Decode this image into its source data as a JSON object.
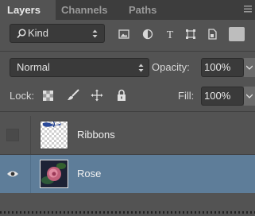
{
  "tabs": [
    {
      "label": "Layers",
      "active": true
    },
    {
      "label": "Channels",
      "active": false
    },
    {
      "label": "Paths",
      "active": false
    }
  ],
  "filter": {
    "kind_label": "Kind",
    "icons": [
      "search-icon",
      "image-filter-icon",
      "adjustment-filter-icon",
      "type-filter-icon",
      "shape-filter-icon",
      "smart-object-filter-icon"
    ]
  },
  "blend": {
    "mode": "Normal",
    "opacity_label": "Opacity:",
    "opacity_value": "100%"
  },
  "lock": {
    "label": "Lock:",
    "icons": [
      "lock-transparent-pixels-icon",
      "lock-image-pixels-icon",
      "lock-position-icon",
      "lock-all-icon"
    ],
    "fill_label": "Fill:",
    "fill_value": "100%"
  },
  "layers": [
    {
      "name": "Ribbons",
      "visible": false,
      "selected": false
    },
    {
      "name": "Rose",
      "visible": true,
      "selected": true
    }
  ],
  "colors": {
    "panel_bg": "#535353",
    "selected_row": "#5e7d99",
    "tab_bar": "#3d3d3d"
  }
}
